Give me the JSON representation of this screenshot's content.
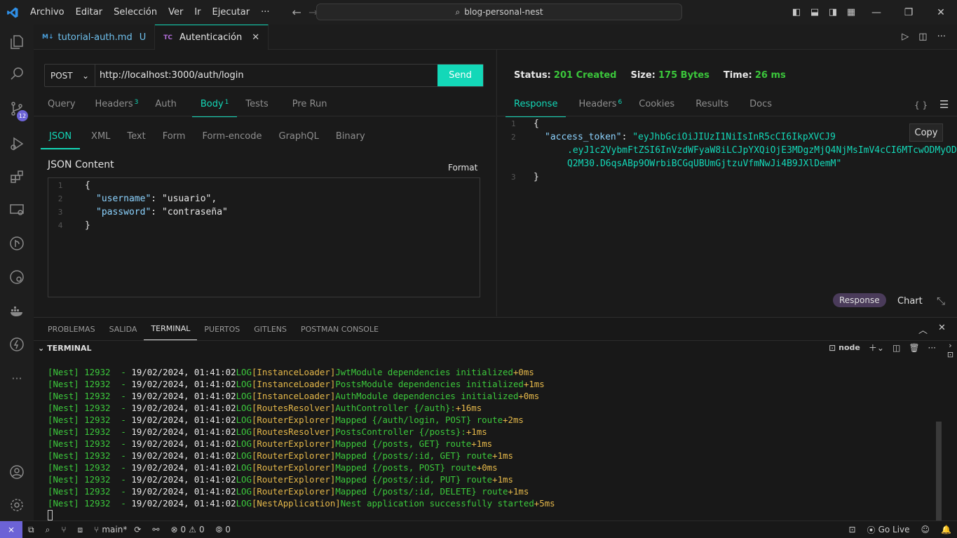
{
  "menu": [
    "Archivo",
    "Editar",
    "Selección",
    "Ver",
    "Ir",
    "Ejecutar",
    "···"
  ],
  "command_center": "blog-personal-nest",
  "activity": {
    "scm_badge": "12"
  },
  "tabs": [
    {
      "icon": "M↓",
      "label": "tutorial-auth.md",
      "flag": "U"
    },
    {
      "icon": "TC",
      "label": "Autenticación",
      "close": "✕"
    }
  ],
  "request": {
    "method": "POST",
    "url": "http://localhost:3000/auth/login",
    "send_label": "Send",
    "tabs": [
      {
        "label": "Query",
        "count": ""
      },
      {
        "label": "Headers",
        "count": "3"
      },
      {
        "label": "Auth",
        "count": ""
      },
      {
        "label": "Body",
        "count": "1"
      },
      {
        "label": "Tests",
        "count": ""
      },
      {
        "label": "Pre Run",
        "count": ""
      }
    ],
    "body_types": [
      "JSON",
      "XML",
      "Text",
      "Form",
      "Form-encode",
      "GraphQL",
      "Binary"
    ],
    "content_label": "JSON Content",
    "format_label": "Format",
    "body_lines": [
      {
        "n": "1",
        "key": "",
        "val": "{"
      },
      {
        "n": "2",
        "key": "\"username\"",
        "val": "\"usuario\","
      },
      {
        "n": "3",
        "key": "\"password\"",
        "val": "\"contraseña\""
      },
      {
        "n": "4",
        "key": "",
        "val": "}"
      }
    ]
  },
  "response": {
    "status_label": "Status:",
    "status_value": "201 Created",
    "size_label": "Size:",
    "size_value": "175 Bytes",
    "time_label": "Time:",
    "time_value": "26 ms",
    "tabs": [
      {
        "label": "Response",
        "count": ""
      },
      {
        "label": "Headers",
        "count": "6"
      },
      {
        "label": "Cookies",
        "count": ""
      },
      {
        "label": "Results",
        "count": ""
      },
      {
        "label": "Docs",
        "count": ""
      }
    ],
    "braces_icon": "{ }",
    "copy_label": "Copy",
    "line_numbers": [
      "1",
      "2",
      "",
      "",
      "3"
    ],
    "open_brace": "{",
    "close_brace": "}",
    "token_key": "\"access_token\"",
    "token_lines": [
      "\"eyJhbGciOiJIUzI1NiIsInR5cCI6IkpXVCJ9",
      ".eyJ1c2VybmFtZSI6InVzdWFyaW8iLCJpYXQiOjE3MDgzMjQ4NjMsImV4cCI6MTcwODMyOD",
      "Q2M30.D6qsABp9OWrbiBCGqUBUmGjtzuVfmNwJi4B9JXlDemM\""
    ],
    "view_pill": "Response",
    "chart_label": "Chart"
  },
  "panel": {
    "tabs": [
      "PROBLEMAS",
      "SALIDA",
      "TERMINAL",
      "PUERTOS",
      "GITLENS",
      "POSTMAN CONSOLE"
    ],
    "terminal_title": "TERMINAL",
    "shell": "node",
    "log": [
      {
        "ctx": "[InstanceLoader]",
        "msg": "JwtModule dependencies initialized",
        "ms": "+0ms"
      },
      {
        "ctx": "[InstanceLoader]",
        "msg": "PostsModule dependencies initialized",
        "ms": "+1ms"
      },
      {
        "ctx": "[InstanceLoader]",
        "msg": "AuthModule dependencies initialized",
        "ms": "+0ms"
      },
      {
        "ctx": "[RoutesResolver]",
        "msg": "AuthController {/auth}:",
        "ms": "+16ms"
      },
      {
        "ctx": "[RouterExplorer]",
        "msg": "Mapped {/auth/login, POST} route",
        "ms": "+2ms"
      },
      {
        "ctx": "[RoutesResolver]",
        "msg": "PostsController {/posts}:",
        "ms": "+1ms"
      },
      {
        "ctx": "[RouterExplorer]",
        "msg": "Mapped {/posts, GET} route",
        "ms": "+1ms"
      },
      {
        "ctx": "[RouterExplorer]",
        "msg": "Mapped {/posts/:id, GET} route",
        "ms": "+1ms"
      },
      {
        "ctx": "[RouterExplorer]",
        "msg": "Mapped {/posts, POST} route",
        "ms": "+0ms"
      },
      {
        "ctx": "[RouterExplorer]",
        "msg": "Mapped {/posts/:id, PUT} route",
        "ms": "+1ms"
      },
      {
        "ctx": "[RouterExplorer]",
        "msg": "Mapped {/posts/:id, DELETE} route",
        "ms": "+1ms"
      },
      {
        "ctx": "[NestApplication]",
        "msg": "Nest application successfully started",
        "ms": "+5ms"
      }
    ],
    "log_prefix": "[Nest] 12932  - ",
    "log_date": "19/02/2024, 01:41:02",
    "log_level": "LOG"
  },
  "statusbar": {
    "branch": "main*",
    "errors": "0",
    "warnings": "0",
    "ports": "0",
    "golive": "Go Live"
  },
  "colors": {
    "accent": "#13d8b8",
    "status_ok": "#3bc63b",
    "remote": "#6c63d6"
  }
}
